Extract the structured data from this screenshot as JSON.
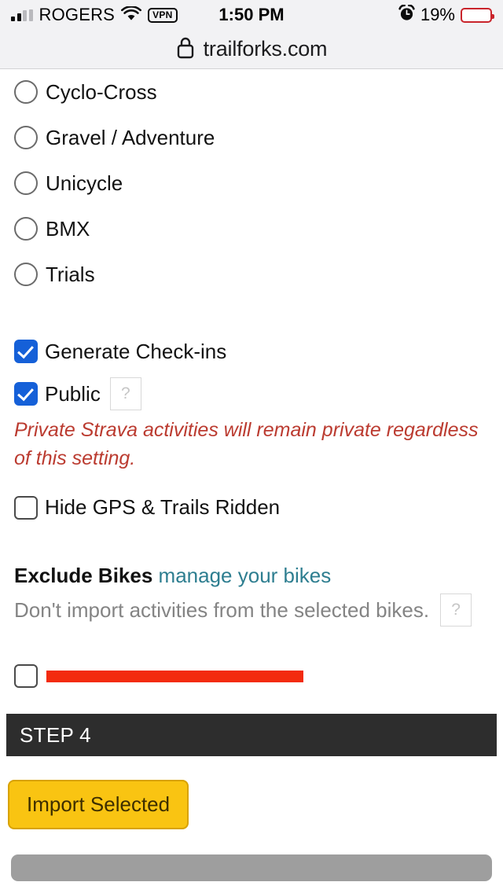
{
  "status_bar": {
    "carrier": "ROGERS",
    "vpn_badge": "VPN",
    "time": "1:50 PM",
    "battery_percent": "19%",
    "battery_level": 19,
    "icons": [
      "signal-bars-icon",
      "wifi-icon",
      "vpn-badge-icon",
      "alarm-clock-icon",
      "battery-icon"
    ]
  },
  "browser": {
    "lock_icon": "lock-icon",
    "url": "trailforks.com"
  },
  "activity_types": {
    "options": [
      {
        "label": "Cyclo-Cross",
        "selected": false
      },
      {
        "label": "Gravel / Adventure",
        "selected": false
      },
      {
        "label": "Unicycle",
        "selected": false
      },
      {
        "label": "BMX",
        "selected": false
      },
      {
        "label": "Trials",
        "selected": false
      }
    ]
  },
  "settings": {
    "generate_checkins": {
      "label": "Generate Check-ins",
      "checked": true
    },
    "public": {
      "label": "Public",
      "checked": true,
      "help": "?"
    },
    "public_warning": "Private Strava activities will remain private regardless of this setting.",
    "hide_gps": {
      "label": "Hide GPS & Trails Ridden",
      "checked": false
    }
  },
  "exclude_bikes": {
    "title": "Exclude Bikes",
    "manage_link": "manage your bikes",
    "description": "Don't import activities from the selected bikes.",
    "help": "?",
    "bike_row": {
      "checked": false,
      "name_redacted": true
    }
  },
  "step": {
    "label": "STEP 4"
  },
  "actions": {
    "import_button": "Import Selected"
  },
  "colors": {
    "checkbox_blue": "#1560d8",
    "link_teal": "#2e7e90",
    "warning_red": "#bb3b30",
    "redaction_red": "#f32b0e",
    "step_bar_dark": "#2d2d2d",
    "button_amber": "#f9c412",
    "bottom_bar_grey": "#9e9e9e"
  }
}
